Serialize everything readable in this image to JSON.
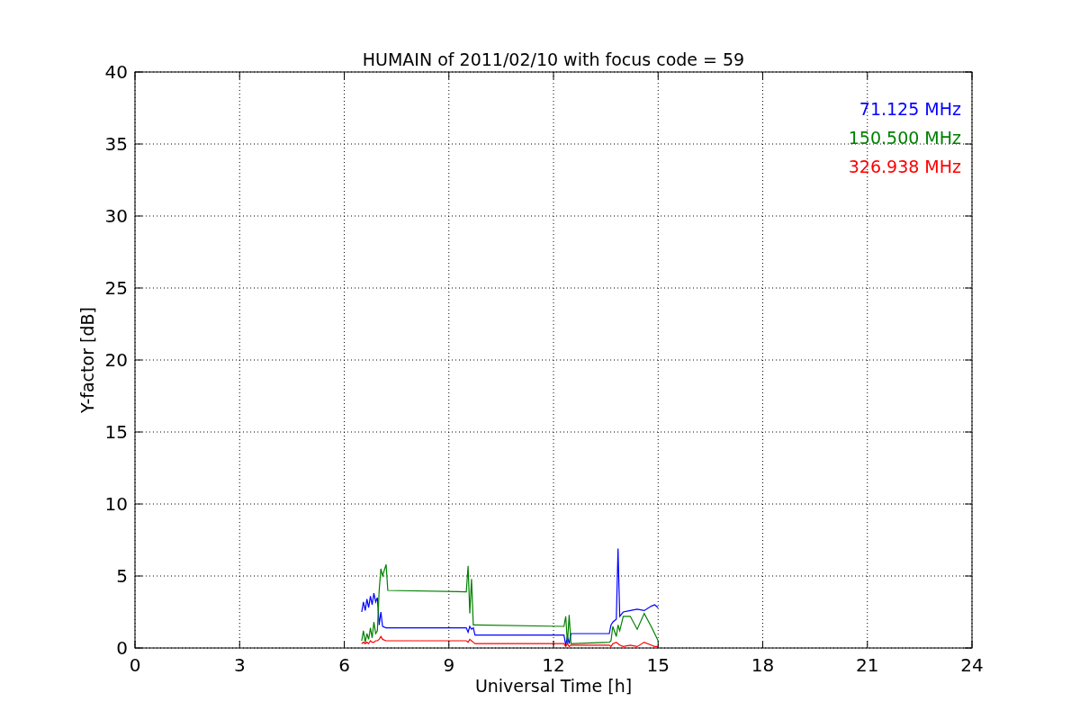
{
  "figure": {
    "chart_data": {
      "type": "line",
      "title": "HUMAIN of 2011/02/10 with focus code = 59",
      "xlabel": "Universal Time [h]",
      "ylabel": "Y-factor [dB]",
      "grid": true,
      "xlim": [
        0,
        24
      ],
      "ylim": [
        0,
        40
      ],
      "xticks": [
        0,
        3,
        6,
        9,
        12,
        15,
        18,
        21,
        24
      ],
      "yticks": [
        0,
        5,
        10,
        15,
        20,
        25,
        30,
        35,
        40
      ],
      "x": [
        6.5,
        6.55,
        6.6,
        6.65,
        6.7,
        6.75,
        6.8,
        6.85,
        6.9,
        6.95,
        7.0,
        7.05,
        7.1,
        7.2,
        7.25,
        9.5,
        9.55,
        9.6,
        9.65,
        9.7,
        9.75,
        12.3,
        12.35,
        12.4,
        12.45,
        12.5,
        12.55,
        13.6,
        13.65,
        13.7,
        13.8,
        13.85,
        13.9,
        14.0,
        14.2,
        14.4,
        14.6,
        14.8,
        14.9,
        15.0
      ],
      "series": [
        {
          "name": "71.125 MHz",
          "color": "#0000ff",
          "values": [
            2.5,
            3.2,
            2.6,
            3.4,
            2.8,
            3.6,
            3.0,
            3.8,
            3.2,
            3.5,
            1.6,
            2.5,
            1.5,
            1.4,
            1.4,
            1.4,
            1.1,
            1.5,
            1.3,
            1.4,
            0.9,
            0.9,
            0.2,
            0.8,
            0.3,
            1.0,
            1.0,
            1.0,
            1.6,
            1.8,
            2.0,
            6.9,
            2.2,
            2.5,
            2.6,
            2.7,
            2.6,
            2.9,
            3.0,
            2.8
          ]
        },
        {
          "name": "150.500 MHz",
          "color": "#008000",
          "values": [
            0.5,
            1.2,
            0.4,
            1.0,
            0.6,
            1.4,
            0.7,
            1.8,
            1.0,
            1.2,
            4.0,
            5.5,
            5.0,
            5.8,
            4.0,
            3.9,
            5.7,
            2.4,
            4.8,
            1.6,
            1.6,
            1.5,
            2.2,
            0.3,
            2.3,
            0.3,
            0.3,
            0.4,
            0.5,
            1.5,
            0.8,
            1.6,
            1.2,
            2.2,
            2.2,
            1.3,
            2.4,
            1.5,
            1.0,
            0.5
          ]
        },
        {
          "name": "326.938 MHz",
          "color": "#ff0000",
          "values": [
            0.3,
            0.4,
            0.3,
            0.4,
            0.3,
            0.5,
            0.4,
            0.4,
            0.5,
            0.5,
            0.6,
            0.8,
            0.6,
            0.5,
            0.5,
            0.5,
            0.4,
            0.6,
            0.5,
            0.4,
            0.3,
            0.3,
            0.1,
            0.3,
            0.1,
            0.2,
            0.2,
            0.2,
            0.1,
            0.3,
            0.4,
            0.3,
            0.2,
            0.1,
            0.2,
            0.1,
            0.4,
            0.2,
            0.1,
            0.1
          ]
        }
      ]
    }
  }
}
